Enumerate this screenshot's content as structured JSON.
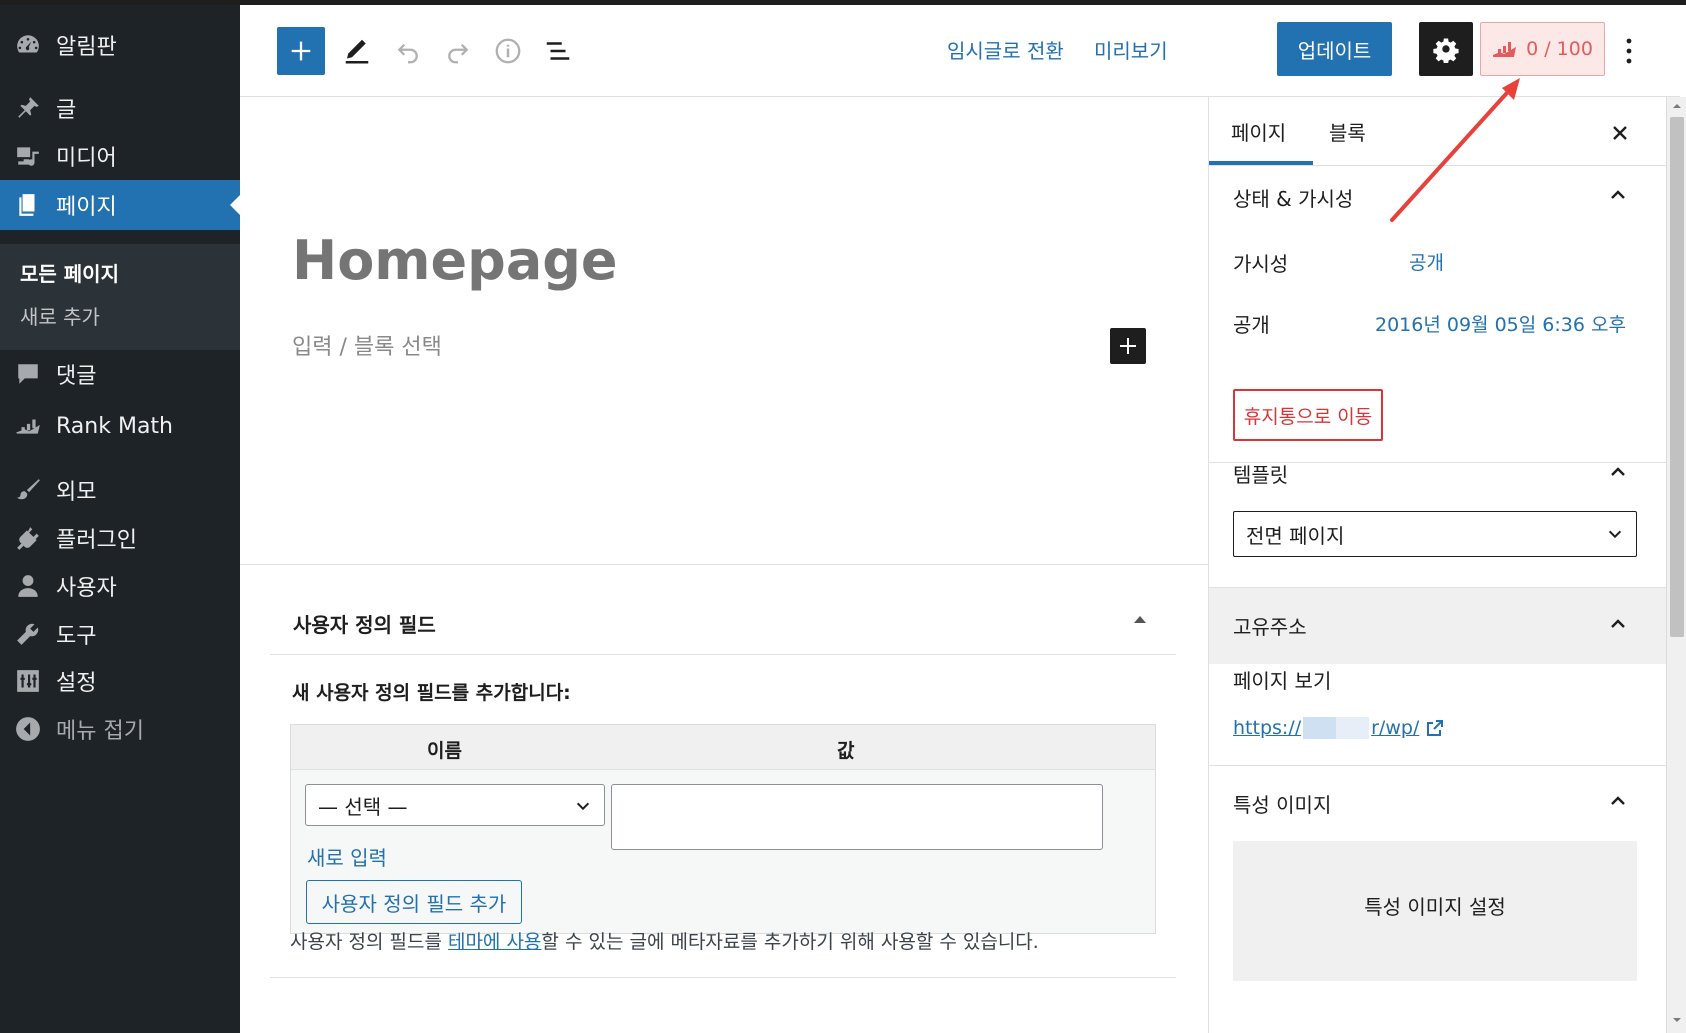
{
  "admin_menu": {
    "items": [
      {
        "label": "알림판",
        "icon": "dashboard-icon"
      },
      {
        "label": "글",
        "icon": "pushpin-icon"
      },
      {
        "label": "미디어",
        "icon": "media-icon"
      },
      {
        "label": "페이지",
        "icon": "pages-icon",
        "active": true
      },
      {
        "label": "댓글",
        "icon": "comments-icon"
      },
      {
        "label": "Rank Math",
        "icon": "rankmath-icon"
      },
      {
        "label": "외모",
        "icon": "paintbrush-icon"
      },
      {
        "label": "플러그인",
        "icon": "plugins-icon"
      },
      {
        "label": "사용자",
        "icon": "users-icon"
      },
      {
        "label": "도구",
        "icon": "wrench-icon"
      },
      {
        "label": "설정",
        "icon": "settings-sliders-icon"
      },
      {
        "label": "메뉴 접기",
        "icon": "collapse-icon"
      }
    ],
    "submenu": {
      "all_pages": "모든 페이지",
      "add_new": "새로 추가"
    }
  },
  "header": {
    "switch_to_draft": "임시글로 전환",
    "preview": "미리보기",
    "update": "업데이트",
    "rank_math_score": "0 / 100"
  },
  "editor": {
    "title": "Homepage",
    "block_placeholder": "입력 / 블록 선택"
  },
  "custom_fields": {
    "title": "사용자 정의 필드",
    "add_new_heading": "새 사용자 정의 필드를 추가합니다:",
    "col_name": "이름",
    "col_value": "값",
    "select_placeholder": "— 선택 —",
    "enter_new": "새로 입력",
    "add_button": "사용자 정의 필드 추가",
    "description_before": "사용자 정의 필드를 ",
    "description_link": "테마에 사용",
    "description_after": "할 수 있는 글에 메타자료를 추가하기 위해 사용할 수 있습니다."
  },
  "sidebar": {
    "tabs": {
      "page": "페이지",
      "block": "블록"
    },
    "status": {
      "title": "상태 & 가시성",
      "visibility_label": "가시성",
      "visibility_value": "공개",
      "publish_label": "공개",
      "publish_value": "2016년 09월 05일 6:36 오후",
      "trash": "휴지통으로 이동"
    },
    "template": {
      "title": "템플릿",
      "value": "전면 페이지"
    },
    "permalink": {
      "title": "고유주소",
      "view_page": "페이지 보기",
      "url_start": "https://",
      "url_end": "r/wp/"
    },
    "featured_image": {
      "title": "특성 이미지",
      "set": "특성 이미지 설정"
    }
  },
  "colors": {
    "accent": "#2271b1",
    "menu_bg": "#1d2327",
    "danger": "#d63638",
    "rankmath": "#e45b5b",
    "annotation": "#e8403a"
  }
}
